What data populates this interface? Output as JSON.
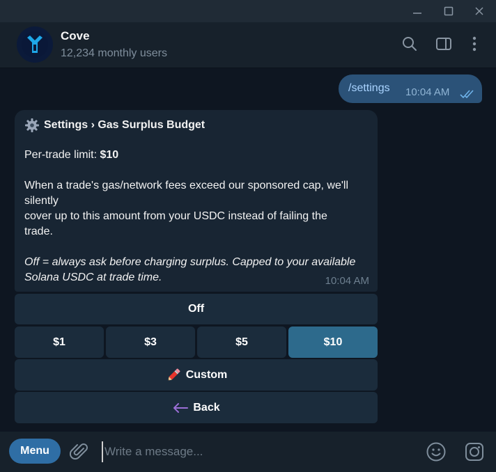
{
  "window": {
    "minimize_icon": "minimize-icon",
    "maximize_icon": "maximize-icon",
    "close_icon": "close-icon"
  },
  "header": {
    "title": "Cove",
    "subtitle": "12,234 monthly users",
    "icons": [
      "search-icon",
      "sidebar-toggle-icon",
      "more-vert-icon"
    ]
  },
  "outgoing": {
    "text": "/settings",
    "time": "10:04 AM",
    "status_icon": "double-check-icon"
  },
  "incoming": {
    "title": "Settings › Gas Surplus Budget",
    "limit_label": "Per-trade limit: ",
    "limit_value": "$10",
    "desc_line1": "When a trade's gas/network fees exceed our sponsored cap, we'll",
    "desc_line2": "silently",
    "desc_line3": "cover up to this amount from your USDC instead of failing the",
    "desc_line4": "trade.",
    "note_line1": "Off = always ask before charging surplus. Capped to your available",
    "note_line2": "Solana USDC at trade time.",
    "time": "10:04 AM"
  },
  "keyboard": {
    "off": "Off",
    "amounts": [
      "$1",
      "$3",
      "$5",
      "$10"
    ],
    "selected": "$10",
    "custom": "Custom",
    "back": "Back"
  },
  "composer": {
    "menu_label": "Menu",
    "placeholder": "Write a message..."
  },
  "colors": {
    "background": "#0e1621",
    "header": "#17212b",
    "outgoing_bubble": "#2b5278",
    "incoming_bubble": "#182533",
    "button": "#1b2c3c",
    "button_active": "#2d6a8c",
    "menu_button": "#2f6ea5"
  }
}
